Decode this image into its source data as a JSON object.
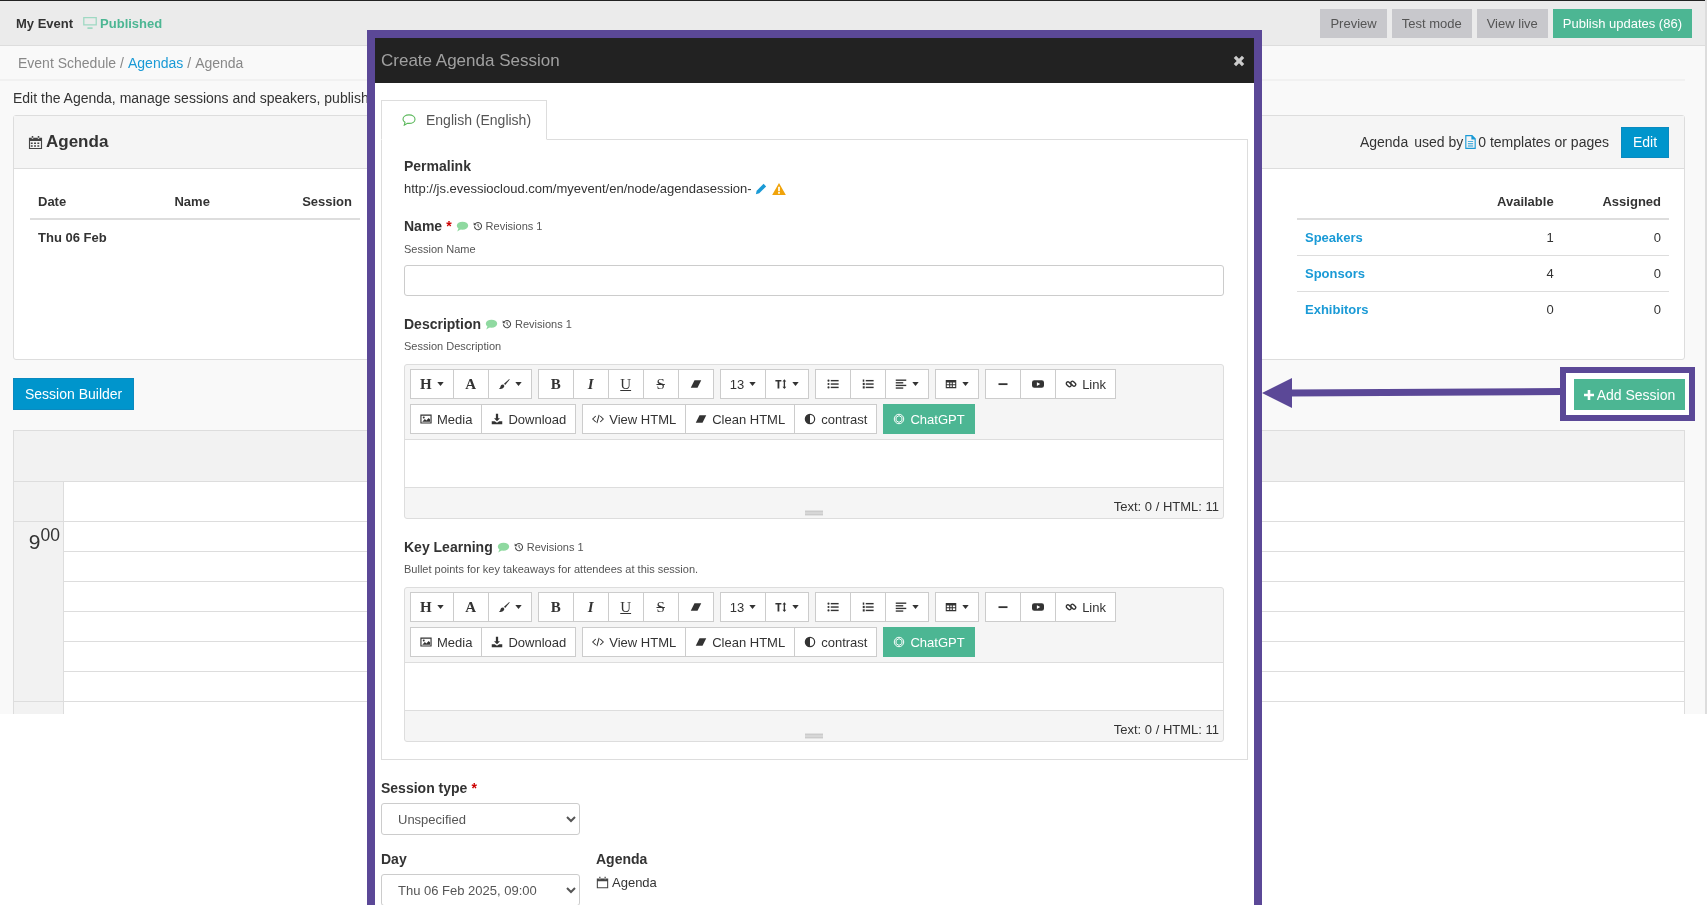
{
  "topbar": {
    "event": "My Event",
    "status": "Published",
    "actions": [
      {
        "label": "Preview",
        "primary": false
      },
      {
        "label": "Test mode",
        "primary": false
      },
      {
        "label": "View live",
        "primary": false
      },
      {
        "label": "Publish updates (86)",
        "primary": true
      }
    ]
  },
  "breadcrumb": [
    {
      "label": "Event Schedule",
      "link": false
    },
    {
      "separator": "/",
      "label": "Agendas",
      "link": true
    },
    {
      "separator": "/",
      "label": "Agenda",
      "link": false
    }
  ],
  "intro": "Edit the Agenda, manage sessions and speakers, publish",
  "agenda_card": {
    "title": "Agenda",
    "usage_label": "Agenda",
    "usage_text": "used by",
    "usage_count": "0 templates or pages",
    "edit_button": "Edit",
    "days_table": {
      "columns": [
        "Date",
        "Name",
        "Session"
      ],
      "rows": [
        {
          "date": "Thu 06 Feb"
        }
      ]
    },
    "resources_table": {
      "columns": [
        "Available",
        "Assigned"
      ],
      "rows": [
        {
          "name": "Speakers",
          "available": "1",
          "assigned": "0"
        },
        {
          "name": "Sponsors",
          "available": "4",
          "assigned": "0"
        },
        {
          "name": "Exhibitors",
          "available": "0",
          "assigned": "0"
        }
      ]
    }
  },
  "session_builder": "Session Builder",
  "add_session": {
    "label": "Add Session",
    "highlighted": true
  },
  "calendar": {
    "hours": [
      {
        "label": "9$^{00}$"
      }
    ]
  },
  "modal": {
    "title": "Create Agenda Session",
    "tabs": [
      {
        "label": "English (English)",
        "selected": true
      }
    ],
    "permalink": {
      "label": "Permalink",
      "url": "http://js.evessiocloud.com/myevent/en/node/agendasession-"
    },
    "name_field": {
      "label": "Name",
      "marker": "*",
      "revisions": "Revisions 1",
      "help": "Session Name"
    },
    "editors": [
      {
        "label": "Description",
        "revisions": "Revisions 1",
        "help": "Session Description",
        "counter": "Text: 0 / HTML: 11",
        "toolbar": [
          [
            [
              {
                "kind": "text",
                "label": "H",
                "caret": true,
                "primary": false
              },
              {
                "kind": "text",
                "label": "A",
                "caret": false,
                "primary": false
              },
              {
                "kind": "icon",
                "caret": true,
                "primary": false
              }
            ],
            [
              {
                "kind": "text",
                "label": "B",
                "caret": false,
                "primary": false
              },
              {
                "kind": "text",
                "label": "I",
                "caret": false,
                "primary": false
              },
              {
                "kind": "text",
                "label": "U",
                "caret": false,
                "primary": false
              },
              {
                "kind": "text",
                "label": "S",
                "caret": false,
                "primary": false
              },
              {
                "kind": "icon",
                "caret": false,
                "primary": false
              }
            ],
            [
              {
                "kind": "text",
                "label": "13",
                "caret": true,
                "primary": false
              },
              {
                "kind": "icon",
                "caret": true,
                "primary": false
              }
            ],
            [
              {
                "kind": "icon",
                "caret": false,
                "primary": false
              },
              {
                "kind": "icon",
                "caret": false,
                "primary": false
              },
              {
                "kind": "icon",
                "caret": true,
                "primary": false
              }
            ],
            [
              {
                "kind": "icon",
                "caret": true,
                "primary": false
              }
            ],
            [
              {
                "kind": "icon",
                "caret": false,
                "primary": false
              },
              {
                "kind": "icon",
                "caret": false,
                "primary": false
              },
              {
                "kind": "icon-text",
                "label": "Link",
                "caret": false,
                "primary": false
              }
            ]
          ],
          [
            [
              {
                "kind": "icon-text",
                "label": "Media",
                "caret": false,
                "primary": false
              },
              {
                "kind": "icon-text",
                "label": "Download",
                "caret": false,
                "primary": false
              }
            ],
            [
              {
                "kind": "icon-text",
                "label": "View HTML",
                "caret": false,
                "primary": false
              },
              {
                "kind": "icon-text",
                "label": "Clean HTML",
                "caret": false,
                "primary": false
              },
              {
                "kind": "icon-text",
                "label": "contrast",
                "caret": false,
                "primary": false
              }
            ],
            [
              {
                "kind": "icon-text",
                "label": "ChatGPT",
                "caret": false,
                "primary": true
              }
            ]
          ]
        ]
      },
      {
        "label": "Key Learning",
        "revisions": "Revisions 1",
        "help": "Bullet points for key takeaways for attendees at this session.",
        "counter": "Text: 0 / HTML: 11",
        "toolbar": [
          [
            [
              {
                "kind": "text",
                "label": "H",
                "caret": true,
                "primary": false
              },
              {
                "kind": "text",
                "label": "A",
                "caret": false,
                "primary": false
              },
              {
                "kind": "icon",
                "caret": true,
                "primary": false
              }
            ],
            [
              {
                "kind": "text",
                "label": "B",
                "caret": false,
                "primary": false
              },
              {
                "kind": "text",
                "label": "I",
                "caret": false,
                "primary": false
              },
              {
                "kind": "text",
                "label": "U",
                "caret": false,
                "primary": false
              },
              {
                "kind": "text",
                "label": "S",
                "caret": false,
                "primary": false
              },
              {
                "kind": "icon",
                "caret": false,
                "primary": false
              }
            ],
            [
              {
                "kind": "text",
                "label": "13",
                "caret": true,
                "primary": false
              },
              {
                "kind": "icon",
                "caret": true,
                "primary": false
              }
            ],
            [
              {
                "kind": "icon",
                "caret": false,
                "primary": false
              },
              {
                "kind": "icon",
                "caret": false,
                "primary": false
              },
              {
                "kind": "icon",
                "caret": true,
                "primary": false
              }
            ],
            [
              {
                "kind": "icon",
                "caret": true,
                "primary": false
              }
            ],
            [
              {
                "kind": "icon",
                "caret": false,
                "primary": false
              },
              {
                "kind": "icon",
                "caret": false,
                "primary": false
              },
              {
                "kind": "icon-text",
                "label": "Link",
                "caret": false,
                "primary": false
              }
            ]
          ],
          [
            [
              {
                "kind": "icon-text",
                "label": "Media",
                "caret": false,
                "primary": false
              },
              {
                "kind": "icon-text",
                "label": "Download",
                "caret": false,
                "primary": false
              }
            ],
            [
              {
                "kind": "icon-text",
                "label": "View HTML",
                "caret": false,
                "primary": false
              },
              {
                "kind": "icon-text",
                "label": "Clean HTML",
                "caret": false,
                "primary": false
              },
              {
                "kind": "icon-text",
                "label": "contrast",
                "caret": false,
                "primary": false
              }
            ],
            [
              {
                "kind": "icon-text",
                "label": "ChatGPT",
                "caret": false,
                "primary": true
              }
            ]
          ]
        ]
      }
    ],
    "session_type": {
      "label": "Session type",
      "marker": "*",
      "value": "Unspecified"
    },
    "day": {
      "label": "Day",
      "value": "Thu 06 Feb 2025, 09:00"
    },
    "agenda": {
      "label": "Agenda",
      "value": "Agenda"
    }
  }
}
